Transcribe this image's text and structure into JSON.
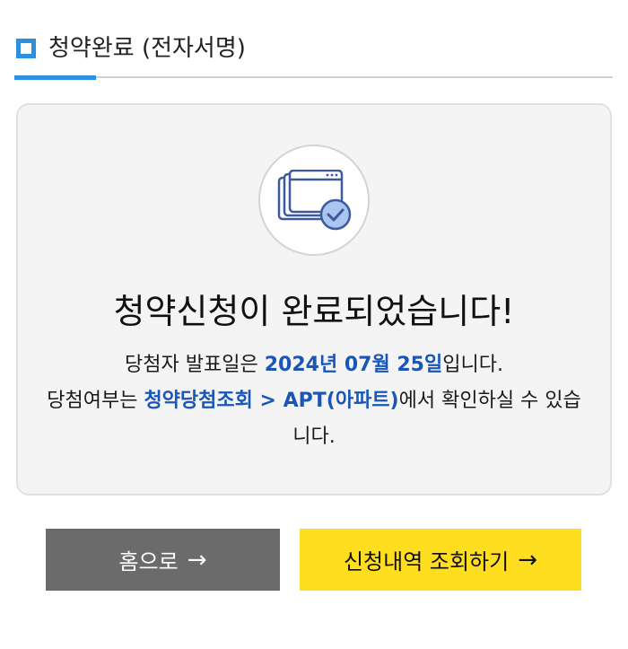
{
  "section": {
    "title": "청약완료 (전자서명)",
    "accent_color": "#2b91df"
  },
  "card": {
    "icon": "browser-windows-check-icon",
    "headline": "청약신청이 완료되었습니다!",
    "info": {
      "line1_prefix": "당첨자 발표일은 ",
      "announcement_date": "2024년 07월 25일",
      "line1_suffix": "입니다.",
      "line2_prefix": "당첨여부는 ",
      "menu_path": "청약당첨조회 > APT(아파트)",
      "line2_suffix": "에서 확인하실 수 있습니다.",
      "highlight_color": "#1a56b8"
    }
  },
  "buttons": {
    "home_label": "홈으로",
    "home_arrow": "→",
    "home_color": "#6b6b6b",
    "history_label": "신청내역 조회하기",
    "history_arrow": "→",
    "history_color": "#ffdd1f"
  }
}
